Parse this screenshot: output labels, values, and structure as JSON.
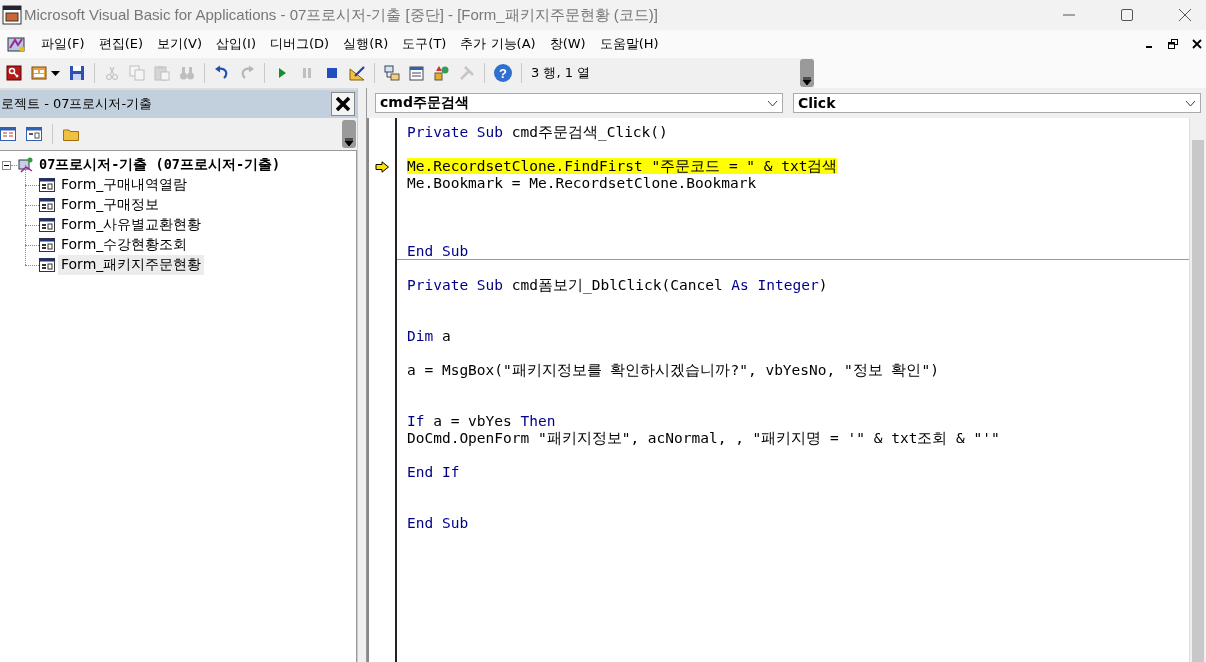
{
  "window": {
    "title": "Microsoft Visual Basic for Applications - 07프로시저-기출 [중단] - [Form_패키지주문현황 (코드)]"
  },
  "menu": [
    "파일(F)",
    "편집(E)",
    "보기(V)",
    "삽입(I)",
    "디버그(D)",
    "실행(R)",
    "도구(T)",
    "추가 기능(A)",
    "창(W)",
    "도움말(H)"
  ],
  "toolbar": {
    "groups": [
      {
        "buttons": [
          {
            "kind": "access",
            "disabled": false
          },
          {
            "kind": "insert",
            "disabled": false
          },
          {
            "kind": "save",
            "disabled": false
          }
        ]
      },
      {
        "buttons": [
          {
            "kind": "cut",
            "disabled": true
          },
          {
            "kind": "copy",
            "disabled": true
          },
          {
            "kind": "paste",
            "disabled": true
          },
          {
            "kind": "find",
            "disabled": true
          }
        ]
      },
      {
        "buttons": [
          {
            "kind": "undo",
            "disabled": false
          },
          {
            "kind": "redo",
            "disabled": true
          }
        ]
      },
      {
        "buttons": [
          {
            "kind": "run",
            "disabled": false
          },
          {
            "kind": "pause",
            "disabled": true
          },
          {
            "kind": "stop",
            "disabled": false
          },
          {
            "kind": "design",
            "disabled": false
          }
        ]
      },
      {
        "buttons": [
          {
            "kind": "project",
            "disabled": false
          },
          {
            "kind": "properties",
            "disabled": false
          },
          {
            "kind": "browser",
            "disabled": false
          },
          {
            "kind": "toolbox",
            "disabled": true
          }
        ]
      },
      {
        "buttons": [
          {
            "kind": "help",
            "disabled": false,
            "glyph": "?"
          }
        ]
      }
    ],
    "position": "3 행, 1 열"
  },
  "project": {
    "title": "로젝트 - 07프로시저-기출",
    "root": {
      "label": "07프로시저-기출 (07프로시저-기출)",
      "expanded": true,
      "children": [
        {
          "label": "Form_구매내역열람",
          "selected": false
        },
        {
          "label": "Form_구매정보",
          "selected": false
        },
        {
          "label": "Form_사유별교환현황",
          "selected": false
        },
        {
          "label": "Form_수강현황조회",
          "selected": false
        },
        {
          "label": "Form_패키지주문현황",
          "selected": true
        }
      ]
    }
  },
  "code": {
    "object": "cmd주문검색",
    "procedure": "Click",
    "procedures": [
      {
        "lines": [
          {
            "kind": "code",
            "current": false,
            "tokens": [
              {
                "kind": "keyword",
                "text": "Private Sub"
              },
              {
                "kind": "plain",
                "text": " cmd주문검색_Click()"
              }
            ]
          },
          {
            "kind": "blank",
            "current": false
          },
          {
            "kind": "code",
            "current": true,
            "tokens": [
              {
                "kind": "plain",
                "text": "Me.RecordsetClone.FindFirst \"주문코드 = \" & txt검색"
              }
            ]
          },
          {
            "kind": "code",
            "current": false,
            "tokens": [
              {
                "kind": "plain",
                "text": "Me.Bookmark = Me.RecordsetClone.Bookmark"
              }
            ]
          },
          {
            "kind": "blank",
            "current": false
          },
          {
            "kind": "blank",
            "current": false
          },
          {
            "kind": "blank",
            "current": false
          },
          {
            "kind": "code",
            "current": false,
            "tokens": [
              {
                "kind": "keyword",
                "text": "End Sub"
              }
            ]
          }
        ]
      },
      {
        "lines": [
          {
            "kind": "blank",
            "current": false
          },
          {
            "kind": "code",
            "current": false,
            "tokens": [
              {
                "kind": "keyword",
                "text": "Private Sub"
              },
              {
                "kind": "plain",
                "text": " cmd폼보기_DblClick(Cancel "
              },
              {
                "kind": "keyword",
                "text": "As Integer"
              },
              {
                "kind": "plain",
                "text": ")"
              }
            ]
          },
          {
            "kind": "blank",
            "current": false
          },
          {
            "kind": "blank",
            "current": false
          },
          {
            "kind": "code",
            "current": false,
            "tokens": [
              {
                "kind": "keyword",
                "text": "Dim"
              },
              {
                "kind": "plain",
                "text": " a"
              }
            ]
          },
          {
            "kind": "blank",
            "current": false
          },
          {
            "kind": "code",
            "current": false,
            "tokens": [
              {
                "kind": "plain",
                "text": "a = MsgBox(\"패키지정보를 확인하시겠습니까?\", vbYesNo, \"정보 확인\")"
              }
            ]
          },
          {
            "kind": "blank",
            "current": false
          },
          {
            "kind": "blank",
            "current": false
          },
          {
            "kind": "code",
            "current": false,
            "tokens": [
              {
                "kind": "keyword",
                "text": "If"
              },
              {
                "kind": "plain",
                "text": " a = vbYes "
              },
              {
                "kind": "keyword",
                "text": "Then"
              }
            ]
          },
          {
            "kind": "code",
            "current": false,
            "tokens": [
              {
                "kind": "plain",
                "text": "DoCmd.OpenForm \"패키지정보\", acNormal, , \"패키지명 = '\" & txt조회 & \"'\""
              }
            ]
          },
          {
            "kind": "blank",
            "current": false
          },
          {
            "kind": "code",
            "current": false,
            "tokens": [
              {
                "kind": "keyword",
                "text": "End If"
              }
            ]
          },
          {
            "kind": "blank",
            "current": false
          },
          {
            "kind": "blank",
            "current": false
          },
          {
            "kind": "code",
            "current": false,
            "tokens": [
              {
                "kind": "keyword",
                "text": "End Sub"
              }
            ]
          }
        ]
      }
    ]
  }
}
